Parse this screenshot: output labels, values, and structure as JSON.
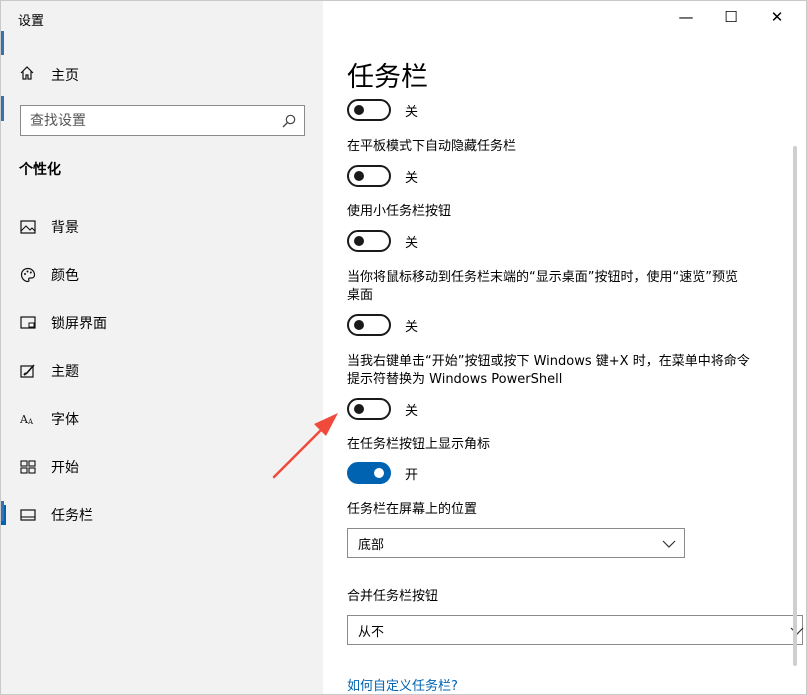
{
  "window": {
    "title": "设置",
    "minimize_glyph": "—",
    "maximize_glyph": "☐",
    "close_glyph": "✕"
  },
  "sidebar": {
    "home_label": "主页",
    "search_placeholder": "查找设置",
    "section_title": "个性化",
    "items": [
      {
        "label": "背景",
        "icon": "picture-icon"
      },
      {
        "label": "颜色",
        "icon": "palette-icon"
      },
      {
        "label": "锁屏界面",
        "icon": "lock-screen-icon"
      },
      {
        "label": "主题",
        "icon": "theme-brush-icon"
      },
      {
        "label": "字体",
        "icon": "font-icon"
      },
      {
        "label": "开始",
        "icon": "start-grid-icon"
      },
      {
        "label": "任务栏",
        "icon": "taskbar-icon",
        "active": true
      }
    ]
  },
  "main": {
    "page_title": "任务栏",
    "settings": [
      {
        "label": "",
        "state": "关",
        "on": false
      },
      {
        "label": "在平板模式下自动隐藏任务栏",
        "state": "关",
        "on": false
      },
      {
        "label": "使用小任务栏按钮",
        "state": "关",
        "on": false
      },
      {
        "label_line1": "当你将鼠标移动到任务栏末端的“显示桌面”按钮时，使用“速览”预览",
        "label_line2": "桌面",
        "state": "关",
        "on": false
      },
      {
        "label_line1": "当我右键单击“开始”按钮或按下 Windows 键+X 时，在菜单中将命令",
        "label_line2": "提示符替换为 Windows PowerShell",
        "state": "关",
        "on": false
      },
      {
        "label": "在任务栏按钮上显示角标",
        "state": "开",
        "on": true
      }
    ],
    "position": {
      "label": "任务栏在屏幕上的位置",
      "value": "底部"
    },
    "combine": {
      "label": "合并任务栏按钮",
      "value": "从不"
    },
    "help_link": "如何自定义任务栏?"
  },
  "colors": {
    "accent": "#0063b1",
    "sidebar_bg": "#f2f2f2",
    "arrow": "#f04a3c"
  }
}
